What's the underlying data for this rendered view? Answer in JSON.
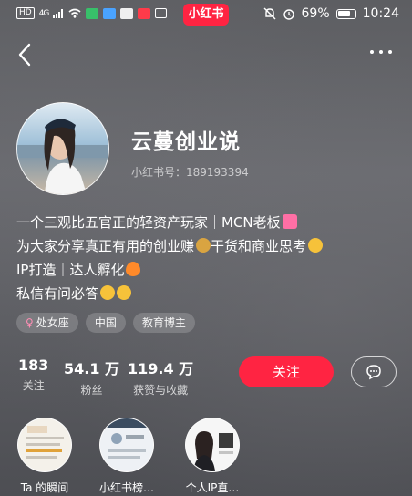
{
  "status_bar": {
    "hd": "HD",
    "network": "4G",
    "battery": "69%",
    "time": "10:24"
  },
  "brand": "小红书",
  "profile": {
    "name": "云蔓创业说",
    "red_id": "小红书号：189193394",
    "bio": [
      "一个三观比五官正的轻资产玩家｜MCN老板",
      "为大家分享真正有用的创业赚",
      "干货和商业思考",
      "IP打造｜达人孵化",
      "私信有问必答"
    ],
    "tags": [
      "处女座",
      "中国",
      "教育博主"
    ],
    "tag_symbol": "♀"
  },
  "stats": [
    {
      "value": "183",
      "label": "关注"
    },
    {
      "value": "54.1 万",
      "label": "粉丝"
    },
    {
      "value": "119.4 万",
      "label": "获赞与收藏"
    }
  ],
  "actions": {
    "follow": "关注"
  },
  "highlights": [
    "Ta 的瞬间",
    "小红书榜…",
    "个人IP直…"
  ],
  "colors": {
    "accent": "#ff2442"
  }
}
